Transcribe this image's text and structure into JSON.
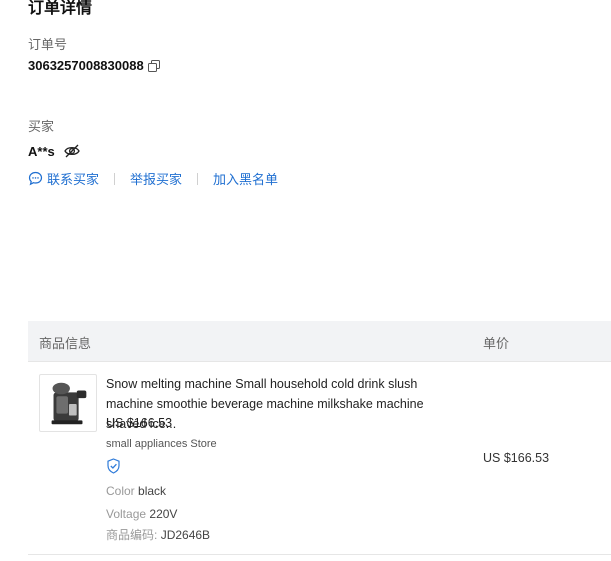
{
  "section": {
    "title": "订单详情"
  },
  "order": {
    "number_label": "订单号",
    "number_value": "3063257008830088"
  },
  "buyer": {
    "label": "买家",
    "name": "A**s"
  },
  "actions": {
    "contact": "联系买家",
    "report": "举报买家",
    "blacklist": "加入黑名单"
  },
  "table": {
    "headers": {
      "product": "商品信息",
      "price": "单价"
    },
    "rows": [
      {
        "title": "Snow melting machine Small household cold drink slush machine smoothie beverage machine milkshake machine shaved ice...",
        "price": "US $166.53",
        "store": "small appliances Store",
        "color_label": "Color",
        "color_value": "black",
        "voltage_label": "Voltage",
        "voltage_value": "220V",
        "code_label": "商品编码:",
        "code_value": "JD2646B",
        "unit_price": "US $166.53"
      }
    ]
  },
  "colors": {
    "link": "#1f6fd1",
    "header_bg": "#f2f3f5",
    "shield": "#2f7bd9"
  },
  "icons": [
    "copy-icon",
    "eye-off-icon",
    "chat-icon",
    "shield-check-icon"
  ]
}
